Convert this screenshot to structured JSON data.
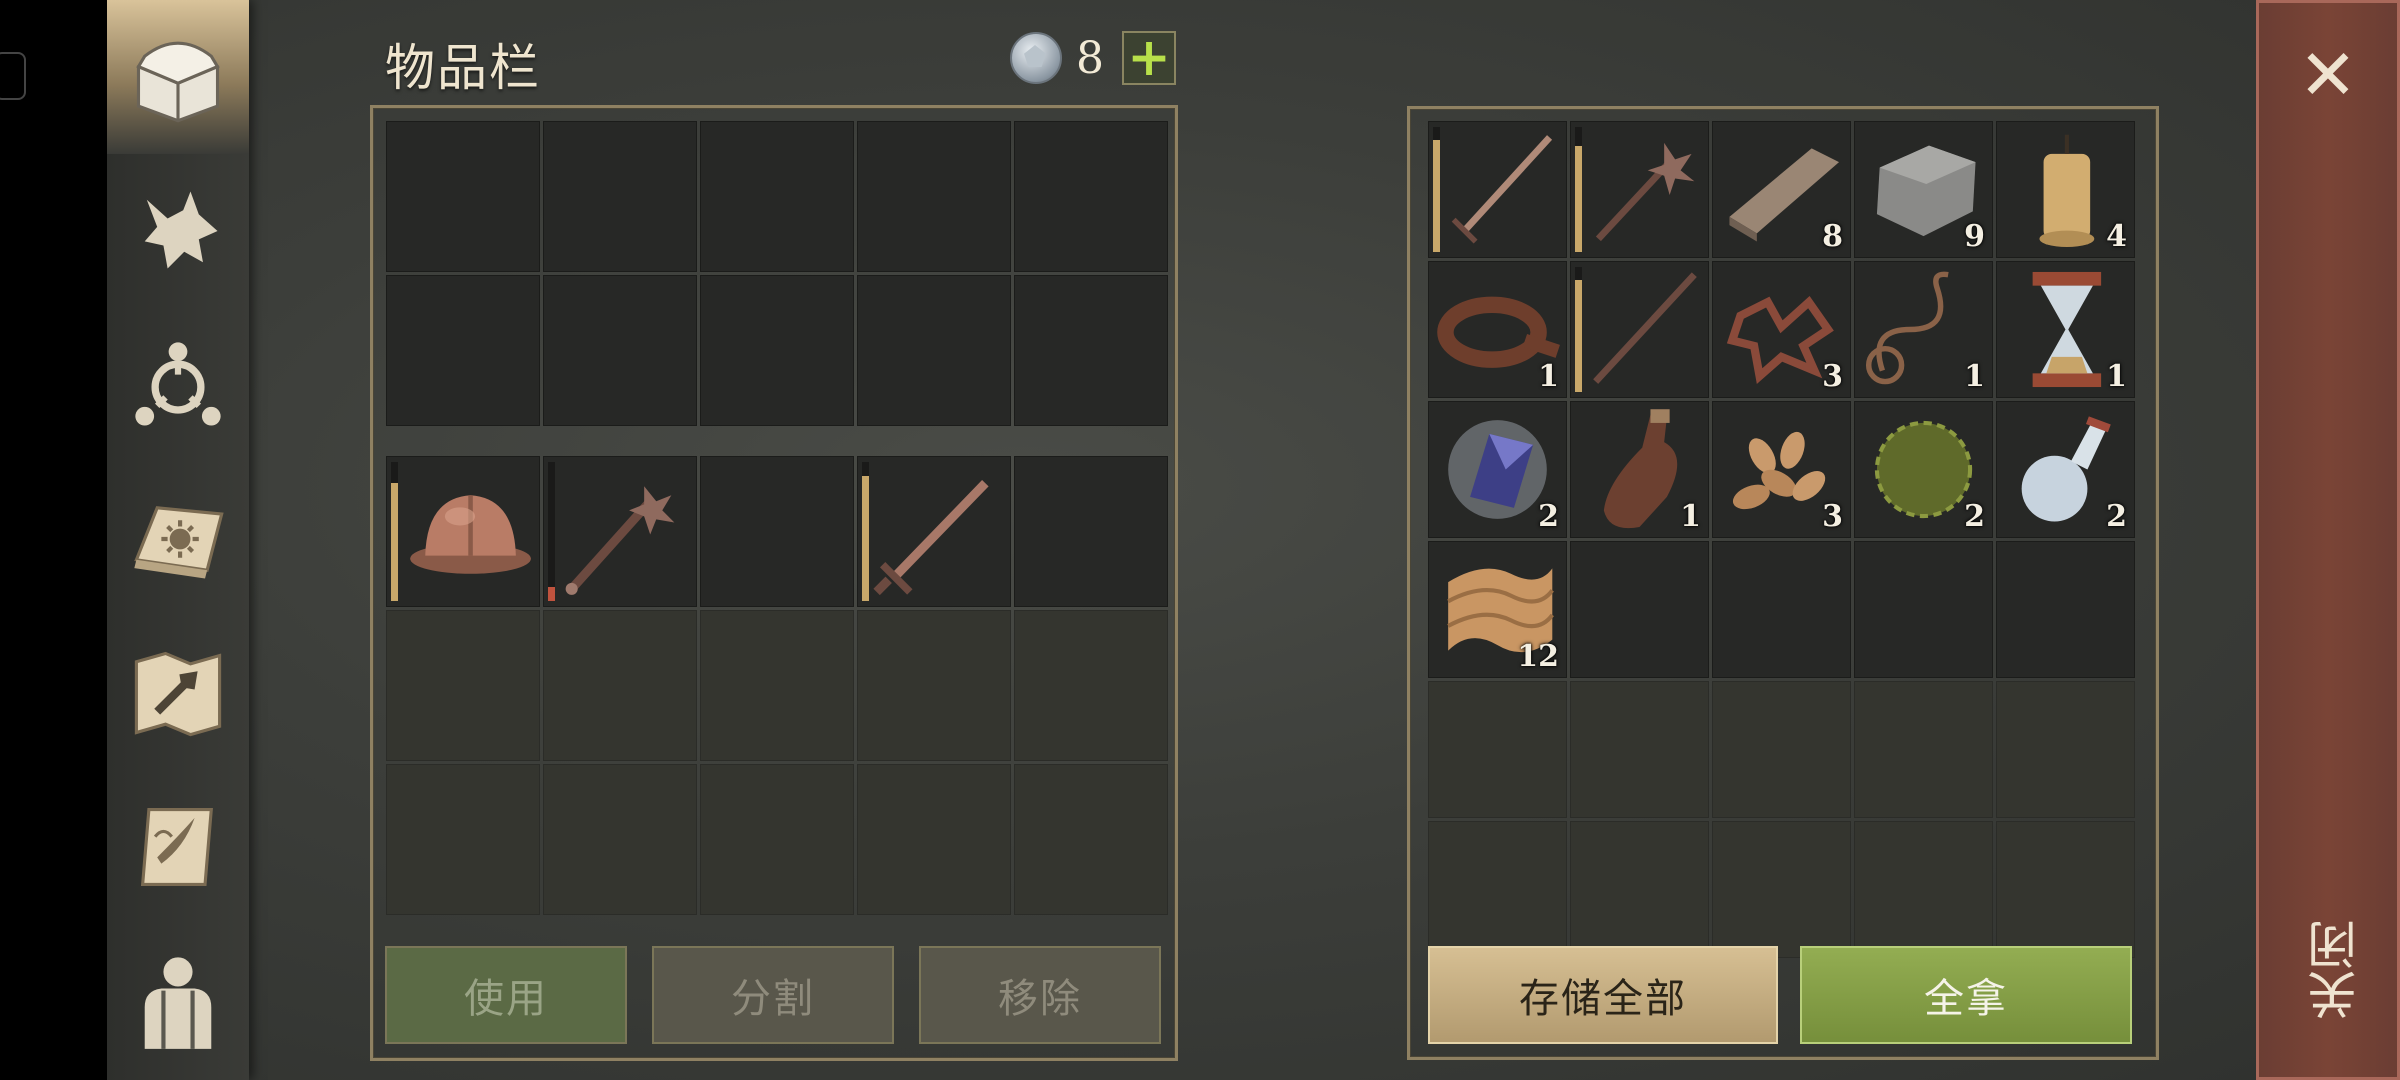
{
  "inventory": {
    "title": "物品栏",
    "currency_count": "8",
    "add_label": "+",
    "slots_top": [
      "",
      "",
      "",
      "",
      "",
      "",
      "",
      "",
      "",
      ""
    ],
    "equipped": [
      {
        "icon": "helmet-icon",
        "durability": 0.85
      },
      {
        "icon": "mace-icon",
        "durability": 0.1
      },
      {
        "icon": "empty",
        "durability": null
      },
      {
        "icon": "sword-icon",
        "durability": 0.9
      },
      {
        "icon": "empty",
        "durability": null
      }
    ],
    "buttons": {
      "use": "使用",
      "split": "分割",
      "remove": "移除"
    }
  },
  "chest": {
    "items": [
      {
        "icon": "sword-icon",
        "count": "",
        "durability": 0.9
      },
      {
        "icon": "mace-icon",
        "count": "",
        "durability": 0.85
      },
      {
        "icon": "wood-plank-icon",
        "count": "8"
      },
      {
        "icon": "stone-icon",
        "count": "9"
      },
      {
        "icon": "candle-icon",
        "count": "4"
      },
      {
        "icon": "leather-icon",
        "count": "1"
      },
      {
        "icon": "stick-icon",
        "count": "",
        "durability": 0.9
      },
      {
        "icon": "fiber-scraps-icon",
        "count": "3"
      },
      {
        "icon": "rope-icon",
        "count": "1"
      },
      {
        "icon": "hourglass-icon",
        "count": "1"
      },
      {
        "icon": "crystal-icon",
        "count": "2"
      },
      {
        "icon": "bottle-icon",
        "count": "1"
      },
      {
        "icon": "seeds-icon",
        "count": "3"
      },
      {
        "icon": "herb-ball-icon",
        "count": "2"
      },
      {
        "icon": "flask-icon",
        "count": "2"
      },
      {
        "icon": "cloth-icon",
        "count": "12"
      }
    ],
    "buttons": {
      "store_all": "存储全部",
      "take_all": "全拿"
    }
  },
  "close": {
    "label": "关闭",
    "x": "✕"
  },
  "colors": {
    "accent_gold": "#c9a86a",
    "accent_green": "#93ad52",
    "close_red": "#7a4436"
  }
}
